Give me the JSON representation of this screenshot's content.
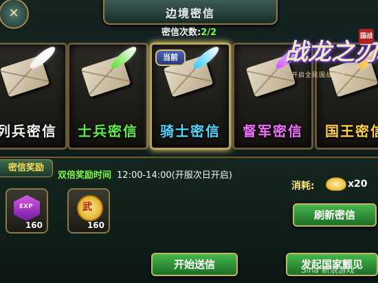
{
  "header": {
    "title": "边境密信",
    "count_label": "密信次数:",
    "count_value": "2/2"
  },
  "cards": [
    {
      "label": "列兵密信",
      "color": "#f4f4f4",
      "feather": "#f0f0f0"
    },
    {
      "label": "士兵密信",
      "color": "#5ff04b",
      "feather": "#5dde35"
    },
    {
      "label": "骑士密信",
      "color": "#51d8ff",
      "feather": "#37c9ff"
    },
    {
      "label": "督军密信",
      "color": "#f171ff",
      "feather": "#d150ff"
    },
    {
      "label": "国王密信",
      "color": "#ffd24a",
      "feather": "#ffbf2d"
    }
  ],
  "current_badge": "当前",
  "logo": {
    "main": "战龙之刃",
    "sub": "开启全民国战时代",
    "seal": "国战"
  },
  "rewards": {
    "tag": "密信奖励",
    "double_time_label": "双倍奖励时间",
    "double_time_value": "12:00-14:00(开服次日开启)",
    "items": [
      {
        "icon": "exp-gem-icon",
        "text": "EXP",
        "qty": "160"
      },
      {
        "icon": "wu-coin-icon",
        "text": "武",
        "qty": "160"
      }
    ]
  },
  "cost": {
    "label": "消耗:",
    "value": "x20",
    "icon": "gold-ingot-icon"
  },
  "buttons": {
    "refresh": "刷新密信",
    "send": "开始送信",
    "national": "发起国家颤见"
  },
  "watermark": "Sina 新浪游戏"
}
